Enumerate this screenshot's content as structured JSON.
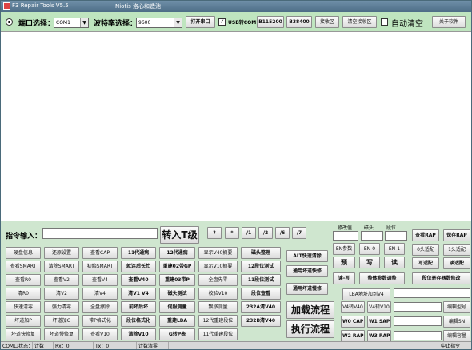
{
  "title": {
    "app": "F3 Repair Tools V5.5",
    "center": "Niotis  洛心和造池"
  },
  "topbar": {
    "port_label": "端口选择：",
    "port_value": "COM1",
    "baud_label": "波特率选择：",
    "baud_value": "9600",
    "open_port": "打开串口",
    "usb_check": "✓",
    "usb_label": "USB转COM",
    "b115200": "B115200",
    "b38400": "B38400",
    "recv_area": "接收区",
    "clear_recv": "清空接收区",
    "auto_clear": "自动清空",
    "about": "关于软件"
  },
  "cmd": {
    "input_label": "指令输入：",
    "enter_t": "转入T级",
    "small": [
      "?",
      "*",
      "/1",
      "/2",
      "/6",
      "/7"
    ]
  },
  "grid": [
    [
      "硬盘信息",
      "还原设置",
      "查看CAP",
      "11代通病",
      "12代通病",
      "显示V40摘要",
      "磁头整理"
    ],
    [
      "查看SMART",
      "清除SMART",
      "初始SMART",
      "就连后长忙",
      "重建02带GP",
      "显示V10摘要",
      "12段位测试"
    ],
    [
      "查看R0",
      "查看V2",
      "查看V4",
      "查看V40",
      "重建03带P",
      "全盘先零",
      "11段位测试"
    ],
    [
      "清R0",
      "清V2",
      "清V4",
      "清V1 V4",
      "磁头测试",
      "校验V10",
      "段位查看"
    ],
    [
      "快速清零",
      "强力清零",
      "全盘擦除",
      "前坏后坏",
      "伺服测量",
      "飘移测量",
      "232A清V40"
    ],
    [
      "坏道加P",
      "坏道加G",
      "带P格式化",
      "段位格式化",
      "重建LBA",
      "12代重建段位",
      "232B清V40"
    ],
    [
      "坏道快修复",
      "坏道慢修复",
      "查看V10",
      "清除V10",
      "G转P表",
      "11代重建段位"
    ]
  ],
  "right_mid": {
    "alt_clear": "ALT快速清除",
    "route_fast": "通用坏道快修",
    "route_slow": "通用坏道慢修",
    "load_flow": "加载流程",
    "exec_flow": "执行流程"
  },
  "right_panel": {
    "head_modify": "修改值",
    "head_head": "磁头",
    "head_seg": "段位",
    "en_param": "EN参数",
    "en0": "EN-0",
    "en1": "EN-1",
    "pre": "预",
    "write": "写",
    "read": "读",
    "read_write": "读-写",
    "whole_adjust": "整体参数调整",
    "lba_add": "LBA地址加到V4",
    "v4_v40": "V4转V40",
    "v4_v10": "V4转V10",
    "w0_cap": "W0 CAP",
    "w1_sap": "W1 SAP",
    "w2_rap": "W2 RAP",
    "w3_rap": "W3 RAP"
  },
  "far_right": {
    "view_rap": "查看RAP",
    "save_rap": "保存RAP",
    "head0": "0头适配",
    "head1": "1头适配",
    "write_adapt": "写适配",
    "read_adapt": "读适配",
    "seg_reg": "段位寄存器数修改",
    "edit_model": "编辑型号",
    "edit_sn": "编辑SN",
    "edit_cap": "编辑容量"
  },
  "status": {
    "com_state": "COM口状态：",
    "count": "计数",
    "rx": "Rx：0",
    "tx": "Tx：0",
    "clear_count": "计数清零",
    "abort": "中止指令"
  }
}
